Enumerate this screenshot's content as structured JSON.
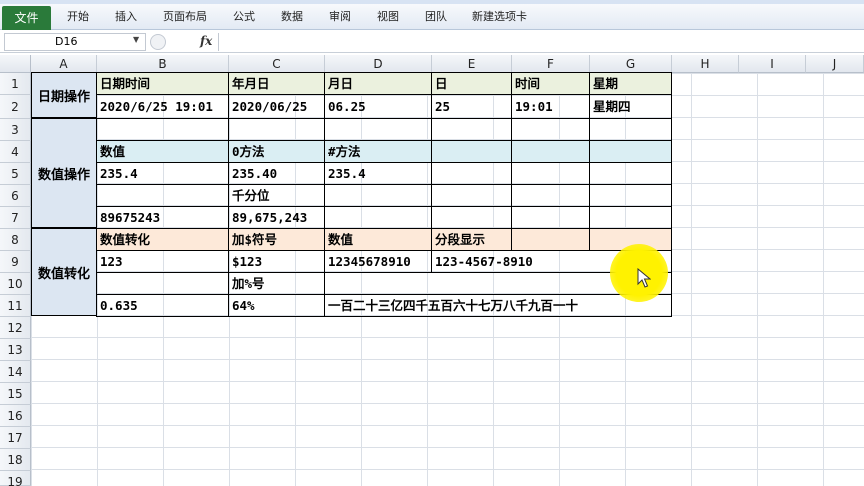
{
  "ribbon": {
    "tabs": [
      "文件",
      "开始",
      "插入",
      "页面布局",
      "公式",
      "数据",
      "审阅",
      "视图",
      "团队",
      "新建选项卡"
    ]
  },
  "formula_bar": {
    "name_box": "D16",
    "fx_label": "fx",
    "content": ""
  },
  "columns": [
    "A",
    "B",
    "C",
    "D",
    "E",
    "F",
    "G",
    "H",
    "I",
    "J"
  ],
  "rows": [
    "1",
    "2",
    "3",
    "4",
    "5",
    "6",
    "7",
    "8",
    "9",
    "10",
    "11",
    "12",
    "13",
    "14",
    "15",
    "16",
    "17",
    "18",
    "19"
  ],
  "section_labels": {
    "date_ops": "日期操作",
    "number_ops": "数值操作",
    "number_convert": "数值转化"
  },
  "cells": {
    "B1": "日期时间",
    "C1": "年月日",
    "D1": "月日",
    "E1": "日",
    "F1": "时间",
    "G1": "星期",
    "B2": "2020/6/25 19:01",
    "C2": "2020/06/25",
    "D2": "06.25",
    "E2": "25",
    "F2": "19:01",
    "G2": "星期四",
    "B4": "数值",
    "C4": "0方法",
    "D4": "#方法",
    "B5": "235.4",
    "C5": "235.40",
    "D5": "235.4",
    "C6": "千分位",
    "B7": "89675243",
    "C7": "89,675,243",
    "B8": "数值转化",
    "C8": "加$符号",
    "D8": "数值",
    "E8": "分段显示",
    "B9": "123",
    "C9": "$123",
    "D9": "12345678910",
    "E9": "123-4567-8910",
    "C10": "加%号",
    "B11": "0.635",
    "C11": "64%",
    "D11": "一百二十三亿四千五百六十七万八千九百一十"
  },
  "colors": {
    "header_green": "#ebf1de",
    "header_blue": "#daeef3",
    "header_orange": "#fde9d9",
    "label_blue": "#dce6f2",
    "file_tab": "#2a7a3a",
    "cursor_highlight": "#fff200"
  }
}
